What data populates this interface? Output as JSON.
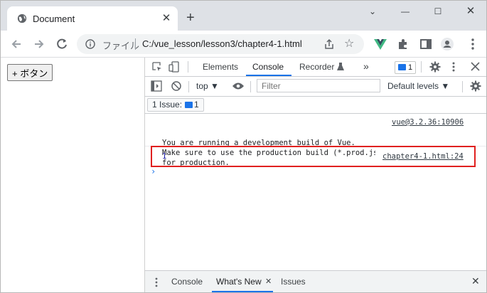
{
  "browser": {
    "tab_title": "Document",
    "tab_close": "✕",
    "new_tab": "+",
    "window_controls": {
      "chevron": "⌄",
      "minimize": "—",
      "maximize": "☐",
      "close": "✕"
    },
    "omnibox": {
      "scheme": "ファイル",
      "url": "C:/vue_lesson/lesson3/chapter4-1.html"
    }
  },
  "page": {
    "button_label": "+ ボタン"
  },
  "devtools": {
    "tabs": [
      "Elements",
      "Console",
      "Recorder"
    ],
    "more_tabs": "»",
    "issue_count": "1",
    "filter_bar": {
      "context": "top",
      "filter_placeholder": "Filter",
      "levels": "Default levels"
    },
    "issues_bar": {
      "label": "1 Issue:",
      "count": "1"
    },
    "messages": [
      {
        "text": "You are running a development build of Vue.\nMake sure to use the production build (*.prod.js) when deploying\nfor production.",
        "source": "vue@3.2.36:10906"
      },
      {
        "text": "1",
        "source": "chapter4-1.html:24"
      }
    ],
    "prompt": "›",
    "drawer": {
      "tabs": [
        "Console",
        "What's New",
        "Issues"
      ],
      "whats_new_close": "✕",
      "close": "✕"
    }
  },
  "colors": {
    "accent": "#1a73e8",
    "highlight_border": "#e0201f",
    "log_number": "#1a1aa6"
  }
}
